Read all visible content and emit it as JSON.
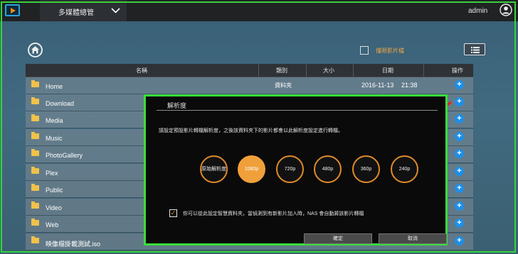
{
  "topbar": {
    "app_title": "多媒體總管",
    "user": "admin",
    "icons": {
      "logo": "media-player-logo-icon",
      "chevron": "chevron-down-icon",
      "user": "user-icon"
    }
  },
  "toolbar": {
    "hidden_label": "僅限影片檔"
  },
  "table": {
    "headers": [
      "名稱",
      "類別",
      "大小",
      "日期",
      "操作"
    ],
    "rows": [
      {
        "name": "Home",
        "type": "資料夾",
        "date": "2016-11-13",
        "time": "21:38"
      },
      {
        "name": "Download"
      },
      {
        "name": "Media"
      },
      {
        "name": "Music"
      },
      {
        "name": "PhotoGallery"
      },
      {
        "name": "Plex"
      },
      {
        "name": "Public"
      },
      {
        "name": "Video"
      },
      {
        "name": "Web"
      },
      {
        "name": "映像檔掛載測試.iso"
      }
    ],
    "action_symbol": "+"
  },
  "dialog": {
    "title": "解析度",
    "description": "請設定預設影片轉檔解析度，之後該資料夾下的影片都會以此解析度設定進行轉檔。",
    "options": [
      "原始解析度",
      "1080p",
      "720p",
      "480p",
      "360p",
      "240p"
    ],
    "selected": "1080p",
    "checkbox_label": "你可以從此設定智慧資料夾，當偵測到有新影片加入時，NAS 會自動將該影片轉檔",
    "checkbox_checked": true,
    "check_mark": "✓",
    "confirm": "確定",
    "cancel": "取消"
  },
  "colors": {
    "accent": "#f0a03a",
    "highlight": "#39de3c",
    "action": "#1e8fe6"
  }
}
